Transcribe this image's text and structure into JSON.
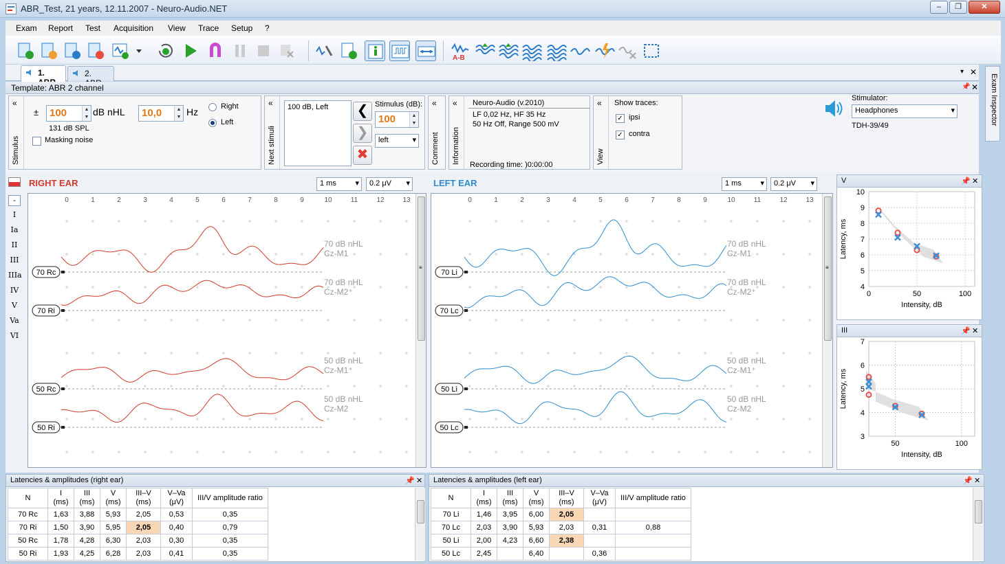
{
  "window": {
    "title": "ABR_Test, 21 years, 12.11.2007 - Neuro-Audio.NET",
    "minimize": "‒",
    "restore": "❐",
    "close": "✕"
  },
  "menu": [
    "Exam",
    "Report",
    "Test",
    "Acquisition",
    "View",
    "Trace",
    "Setup",
    "?"
  ],
  "toolbar_icons": [
    "new-exam-icon",
    "open-exam-icon",
    "save-exam-icon",
    "export-icon",
    "add-test-icon",
    "dropdown-arrow-icon",
    "record-icon",
    "play-icon",
    "magnet-icon",
    "pause-icon",
    "stop-icon",
    "clear-icon",
    "inspect-tool-icon",
    "new-trace-icon",
    "info-panel-icon",
    "waveform-panel-icon",
    "link-icon",
    "a-minus-b-icon",
    "add-wave-icon",
    "sum-wave-icon",
    "multi-wave-icon",
    "wave-stack-icon",
    "single-wave-icon",
    "lightning-wave-icon",
    "delete-wave-icon",
    "select-rect-icon"
  ],
  "tabs": [
    {
      "label": "1. ABR"
    },
    {
      "label": "2. ABR"
    }
  ],
  "template": {
    "title": "Template: ABR 2 channel"
  },
  "stimulus": {
    "group_label": "Stimulus",
    "plusminus": "±",
    "level": "100",
    "level_unit": "dB nHL",
    "spl": "131 dB SPL",
    "rate": "10,0",
    "rate_unit": "Hz",
    "right": "Right",
    "left": "Left",
    "ear_selected": "Left",
    "masking": "Masking noise",
    "masking_checked": false
  },
  "next_stimuli": {
    "group_label": "Next stimuli",
    "list": [
      "100 dB, Left"
    ],
    "stim_label": "Stimulus (dB):",
    "stim_value": "100",
    "ear_value": "left"
  },
  "comment": {
    "group_label": "Comment"
  },
  "information": {
    "group_label": "Information",
    "title": "Neuro-Audio (v.2010)",
    "line1": "LF  0,02 Hz, HF  35 Hz",
    "line2": "50 Hz  Off, Range 500 mV",
    "recording": "Recording time: )0:00:00"
  },
  "view": {
    "group_label": "View",
    "show_traces": "Show traces:",
    "ipsi": "ipsi",
    "contra": "contra",
    "ipsi_checked": true,
    "contra_checked": true
  },
  "stimulator": {
    "label": "Stimulator:",
    "value": "Headphones",
    "model": "TDH-39/49"
  },
  "markers": [
    "-",
    "I",
    "Ia",
    "II",
    "III",
    "IIIa",
    "IV",
    "V",
    "Va",
    "VI"
  ],
  "right_ear": {
    "title": "RIGHT EAR",
    "timebase": "1 ms",
    "gain": "0.2 μV",
    "color": "#d13a2c",
    "x_ticks": [
      "0",
      "1",
      "2",
      "3",
      "4",
      "5",
      "6",
      "7",
      "8",
      "9",
      "10",
      "11",
      "12",
      "13"
    ],
    "traces": [
      {
        "label": "70 Rc",
        "level": "70 dB nHL",
        "montage": "Cz-M1"
      },
      {
        "label": "70 Ri",
        "level": "70 dB nHL",
        "montage": "Cz-M2⁺"
      },
      {
        "label": "50 Rc",
        "level": "50 dB nHL",
        "montage": "Cz-M1⁺"
      },
      {
        "label": "50 Ri",
        "level": "50 dB nHL",
        "montage": "Cz-M2"
      }
    ]
  },
  "left_ear": {
    "title": "LEFT EAR",
    "timebase": "1 ms",
    "gain": "0.2 μV",
    "color": "#2d8ccf",
    "x_ticks": [
      "0",
      "1",
      "2",
      "3",
      "4",
      "5",
      "6",
      "7",
      "8",
      "9",
      "10",
      "11",
      "12",
      "13"
    ],
    "traces": [
      {
        "label": "70 Li",
        "level": "70 dB nHL",
        "montage": "Cz-M1"
      },
      {
        "label": "70 Lc",
        "level": "70 dB nHL",
        "montage": "Cz-M2⁺"
      },
      {
        "label": "50 Li",
        "level": "50 dB nHL",
        "montage": "Cz-M1⁺"
      },
      {
        "label": "50 Lc",
        "level": "50 dB nHL",
        "montage": "Cz-M2"
      }
    ]
  },
  "chart_data": [
    {
      "type": "scatter",
      "title": "V",
      "xlabel": "Intensity, dB",
      "ylabel": "Latency, ms",
      "xlim": [
        0,
        110
      ],
      "ylim": [
        4,
        10
      ],
      "x_ticks": [
        0,
        50,
        100
      ],
      "y_ticks": [
        4,
        5,
        6,
        7,
        8,
        9,
        10
      ],
      "grid": true,
      "series": [
        {
          "marker": "circle",
          "color": "#e85050",
          "x": [
            10,
            30,
            50,
            70
          ],
          "y": [
            8.8,
            7.4,
            6.3,
            5.9
          ]
        },
        {
          "marker": "x",
          "color": "#3d8fd8",
          "x": [
            10,
            30,
            50,
            70
          ],
          "y": [
            8.55,
            7.1,
            6.55,
            5.95
          ]
        }
      ]
    },
    {
      "type": "scatter",
      "title": "III",
      "xlabel": "Intensity, dB",
      "ylabel": "Latency, ms",
      "xlim": [
        30,
        110
      ],
      "ylim": [
        3,
        7
      ],
      "x_ticks": [
        50,
        100
      ],
      "y_ticks": [
        3,
        4,
        5,
        6,
        7
      ],
      "grid": true,
      "series": [
        {
          "marker": "circle",
          "color": "#e85050",
          "x": [
            30,
            30,
            50,
            70
          ],
          "y": [
            5.5,
            4.75,
            4.28,
            3.95
          ]
        },
        {
          "marker": "x",
          "color": "#3d8fd8",
          "x": [
            30,
            30,
            50,
            70
          ],
          "y": [
            5.3,
            5.1,
            4.23,
            3.9
          ]
        }
      ]
    }
  ],
  "lat_right": {
    "title": "Latencies & amplitudes (right ear)",
    "headers": [
      [
        "N",
        ""
      ],
      [
        "I",
        "(ms)"
      ],
      [
        "III",
        "(ms)"
      ],
      [
        "V",
        "(ms)"
      ],
      [
        "III–V",
        "(ms)"
      ],
      [
        "V–Va",
        "(μV)"
      ],
      [
        "III/V amplitude ratio",
        ""
      ]
    ],
    "rows": [
      [
        "70 Rc",
        "1,63",
        "3,88",
        "5,93",
        "2,05",
        "0,53",
        "0,35"
      ],
      [
        "70 Ri",
        "1,50",
        "3,90",
        "5,95",
        "2,05",
        "0,40",
        "0,79"
      ],
      [
        "50 Rc",
        "1,78",
        "4,28",
        "6,30",
        "2,03",
        "0,30",
        "0,35"
      ],
      [
        "50 Ri",
        "1,93",
        "4,25",
        "6,28",
        "2,03",
        "0,41",
        "0,35"
      ]
    ]
  },
  "lat_left": {
    "title": "Latencies & amplitudes (left ear)",
    "headers": [
      [
        "N",
        ""
      ],
      [
        "I",
        "(ms)"
      ],
      [
        "III",
        "(ms)"
      ],
      [
        "V",
        "(ms)"
      ],
      [
        "III–V",
        "(ms)"
      ],
      [
        "V–Va",
        "(μV)"
      ],
      [
        "III/V amplitude ratio",
        ""
      ]
    ],
    "rows": [
      [
        "70 Li",
        "1,46",
        "3,95",
        "6,00",
        "2,05",
        "",
        ""
      ],
      [
        "70 Lc",
        "2,03",
        "3,90",
        "5,93",
        "2,03",
        "0,31",
        "0,88"
      ],
      [
        "50 Li",
        "2,00",
        "4,23",
        "6,60",
        "2,38",
        "",
        ""
      ],
      [
        "50 Lc",
        "2,45",
        "",
        "6,40",
        "",
        "0,36",
        ""
      ]
    ]
  },
  "inspector": {
    "label": "Exam Inspector"
  },
  "glyphs": {
    "collapse": "«",
    "pin": "📌",
    "close": "✕",
    "dropdown": "▾",
    "scroll_grip": "≡",
    "nav_prev": "❮",
    "nav_next": "❯",
    "nav_delete": "✖"
  }
}
